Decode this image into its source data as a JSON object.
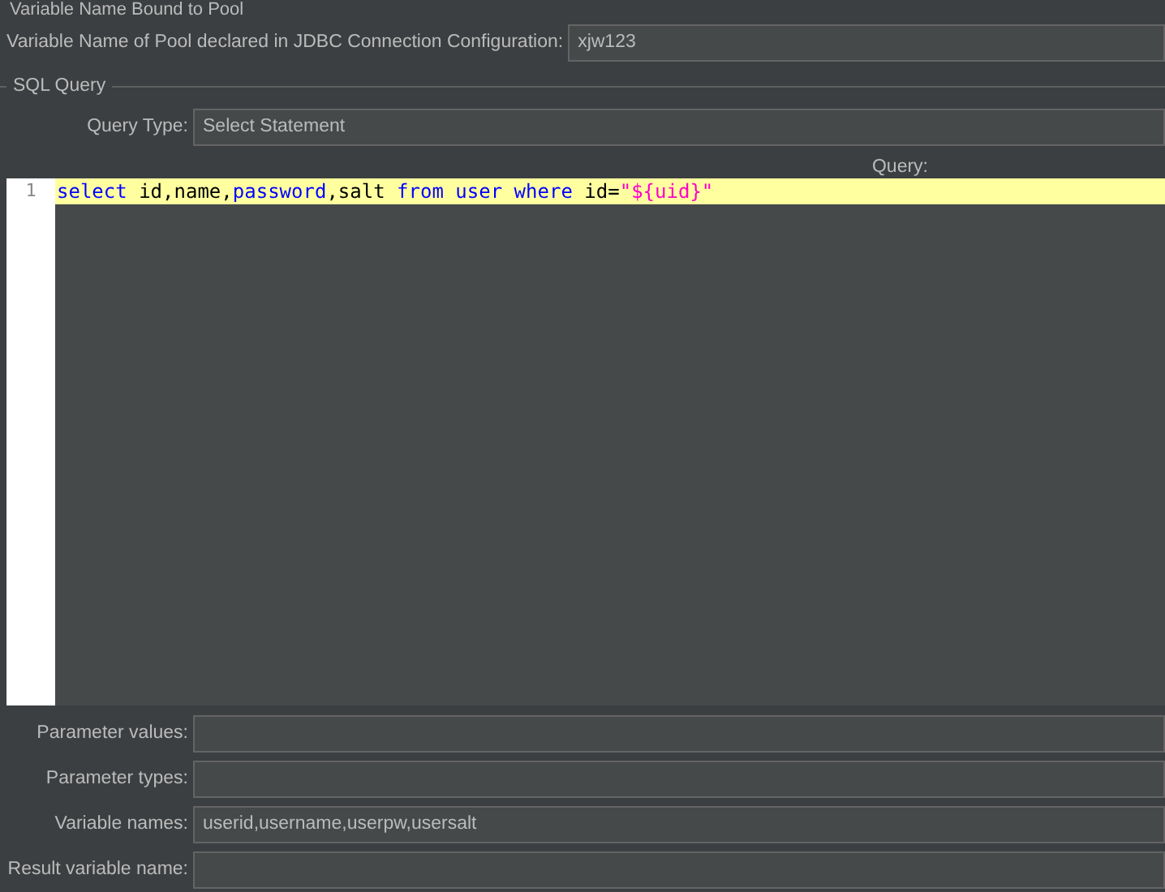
{
  "pool_section": {
    "title": "Variable Name Bound to Pool",
    "label": "Variable Name of Pool declared in JDBC Connection Configuration:",
    "value": "xjw123"
  },
  "sql_section": {
    "title": "SQL Query",
    "query_type": {
      "label": "Query Type:",
      "value": "Select Statement"
    },
    "query_label": "Query:",
    "editor": {
      "lines": [
        {
          "number": "1",
          "highlighted": true,
          "tokens": [
            {
              "kind": "keyword",
              "text": "select"
            },
            {
              "kind": "plain",
              "text": " id,name,"
            },
            {
              "kind": "keyword",
              "text": "password"
            },
            {
              "kind": "plain",
              "text": ",salt "
            },
            {
              "kind": "keyword",
              "text": "from"
            },
            {
              "kind": "keyword",
              "text": " user"
            },
            {
              "kind": "keyword",
              "text": " where"
            },
            {
              "kind": "plain",
              "text": " id="
            },
            {
              "kind": "string",
              "text": "\"${uid}\""
            }
          ]
        }
      ]
    }
  },
  "fields": [
    {
      "label": "Parameter values:"
    },
    {
      "label": "Parameter types:"
    },
    {
      "label": "Variable names:",
      "value": "userid,username,userpw,usersalt"
    },
    {
      "label": "Result variable name:"
    }
  ]
}
